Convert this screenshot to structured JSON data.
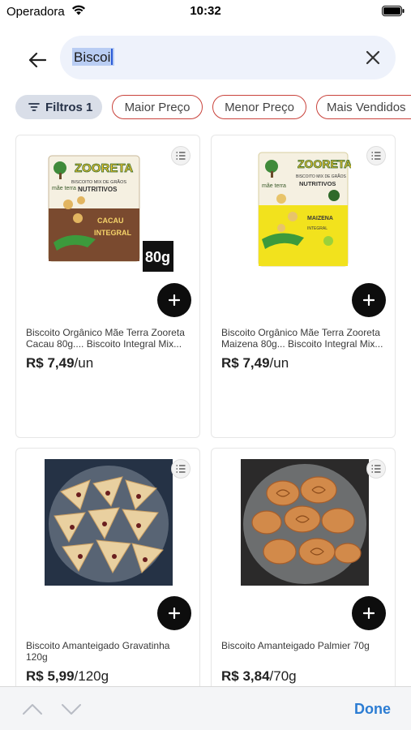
{
  "status_bar": {
    "carrier": "Operadora",
    "time": "10:32"
  },
  "search": {
    "value": "Biscoi"
  },
  "filters": {
    "filter_label": "Filtros",
    "filter_count": "1",
    "chips": [
      "Maior Preço",
      "Menor Preço",
      "Mais Vendidos"
    ]
  },
  "products": [
    {
      "name": "Biscoito Orgânico Mãe Terra Zooreta Cacau 80g.... Biscoito Integral Mix...",
      "price": "R$ 7,49",
      "unit": "/un",
      "package": {
        "brand": "ZOORETA",
        "maker": "mãe terra",
        "line1": "BISCOITO MIX DE GRÃOS",
        "line2": "NUTRITIVOS",
        "flavor": "CACAU",
        "flavor2": "INTEGRAL",
        "weight": "80g",
        "color": "#7a4a2f"
      }
    },
    {
      "name": "Biscoito Orgânico Mãe Terra Zooreta Maizena 80g... Biscoito Integral Mix...",
      "price": "R$ 7,49",
      "unit": "/un",
      "package": {
        "brand": "ZOORETA",
        "maker": "mãe terra",
        "line1": "BISCOITO MIX DE GRÃOS",
        "line2": "NUTRITIVOS",
        "flavor": "MAIZENA",
        "flavor2": "INTEGRAL",
        "color": "#f2e21d"
      }
    },
    {
      "name": "Biscoito Amanteigado Gravatinha 120g",
      "price": "R$ 5,99",
      "unit": "/120g"
    },
    {
      "name": "Biscoito Amanteigado Palmier 70g",
      "price": "R$ 3,84",
      "unit": "/70g"
    }
  ],
  "accessory_bar": {
    "done_label": "Done"
  },
  "colors": {
    "accent_chip_border": "#c9433c",
    "done_blue": "#2b7cd3",
    "search_bg": "#eef2fb"
  }
}
